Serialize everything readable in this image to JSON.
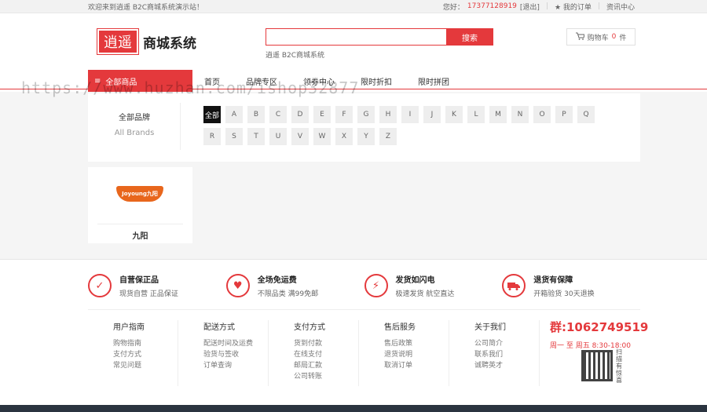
{
  "topbar": {
    "welcome": "欢迎来到逍遥 B2C商城系统演示站！",
    "greeting": "您好：",
    "phone": "17377128919",
    "logout": "[退出]",
    "my_orders": "★ 我的订单",
    "news": "资讯中心"
  },
  "header": {
    "logo_mark": "逍遥",
    "logo_text": "商城系统",
    "search_placeholder": "",
    "search_button": "搜索",
    "search_hint": "逍遥  B2C商城系统",
    "cart_label": "购物车",
    "cart_count": "0",
    "cart_unit": "件"
  },
  "nav": {
    "all_goods": "全部商品",
    "links": [
      "首页",
      "品牌专区",
      "领券中心",
      "限时折扣",
      "限时拼团"
    ]
  },
  "watermark": "https://www.huzhan.com/ishop32877",
  "brand_filter": {
    "title_cn": "全部品牌",
    "title_en": "All Brands",
    "letters": [
      "全部",
      "A",
      "B",
      "C",
      "D",
      "E",
      "F",
      "G",
      "H",
      "I",
      "J",
      "K",
      "L",
      "M",
      "N",
      "O",
      "P",
      "Q",
      "R",
      "S",
      "T",
      "U",
      "V",
      "W",
      "X",
      "Y",
      "Z"
    ]
  },
  "brands": [
    {
      "logo_text": "Joyoung九阳",
      "name": "九阳"
    }
  ],
  "services": [
    {
      "title": "自营保正品",
      "sub": "现货自营 正品保证",
      "icon": "shield-icon"
    },
    {
      "title": "全场免运费",
      "sub": "不限品类 满99免邮",
      "icon": "hands-heart-icon"
    },
    {
      "title": "发货如闪电",
      "sub": "极速发货 航空直达",
      "icon": "lightning-icon"
    },
    {
      "title": "退货有保障",
      "sub": "开箱验货 30天退换",
      "icon": "truck-icon"
    }
  ],
  "footer_cols": [
    {
      "title": "用户指南",
      "items": [
        "购物指南",
        "支付方式",
        "常见问题"
      ]
    },
    {
      "title": "配送方式",
      "items": [
        "配送时间及运费",
        "验货与签收",
        "订单查询"
      ]
    },
    {
      "title": "支付方式",
      "items": [
        "货到付款",
        "在线支付",
        "邮局汇款",
        "公司转账"
      ]
    },
    {
      "title": "售后服务",
      "items": [
        "售后政策",
        "退货说明",
        "取消订单"
      ]
    },
    {
      "title": "关于我们",
      "items": [
        "公司简介",
        "联系我们",
        "诚聘英才"
      ]
    }
  ],
  "contact": {
    "qq_group": "群:1062749519",
    "hours": "周一 至 周五   8:30-18:00",
    "qr_label": "扫描有惊喜"
  }
}
